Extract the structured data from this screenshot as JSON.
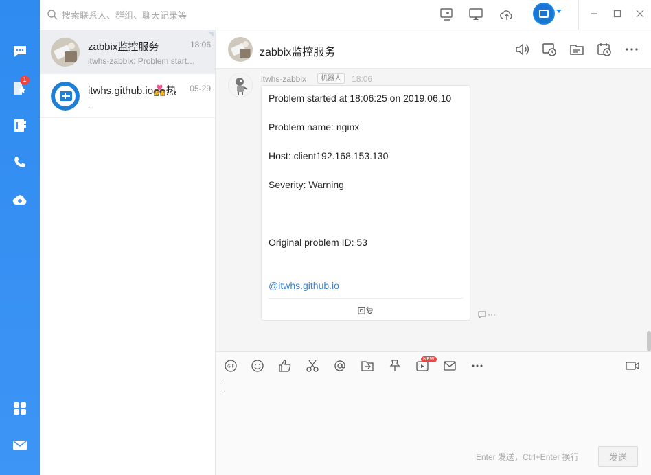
{
  "rail": {
    "badge_count": "1",
    "items": [
      "chat-icon",
      "star-icon",
      "contacts-icon",
      "phone-icon",
      "cloud-icon",
      "apps-icon",
      "mail-icon"
    ],
    "color": "#3d95f5"
  },
  "topbar": {
    "search_placeholder": "搜索联系人、群组、聊天记录等",
    "icons": [
      "add-screen-icon",
      "share-screen-icon",
      "cloud-upload-icon"
    ]
  },
  "conversations": [
    {
      "title": "zabbix监控服务",
      "time": "18:06",
      "preview": "itwhs-zabbix: Problem started at 18:06:25 on 2019.06.10"
    },
    {
      "title": "itwhs.github.io💑热...",
      "time": "05-29",
      "preview": "."
    }
  ],
  "chat": {
    "title": "zabbix监控服务",
    "sender": "itwhs-zabbix",
    "bot_tag": "机器人",
    "time": "18:06",
    "lines": {
      "started": "Problem started at 18:06:25 on 2019.06.10",
      "name": "Problem name: nginx",
      "host": "Host: client192.168.153.130",
      "severity": "Severity: Warning",
      "original_id": "Original problem ID: 53",
      "mention": "@itwhs.github.io"
    },
    "reply": "回复",
    "more_dots": "···"
  },
  "input": {
    "new_tag": "NEW",
    "hint": "Enter 发送，Ctrl+Enter 换行",
    "send_label": "发送"
  },
  "colors": {
    "accent": "#3b82d6",
    "rail": "#3d95f5",
    "badge": "#f4433d"
  }
}
